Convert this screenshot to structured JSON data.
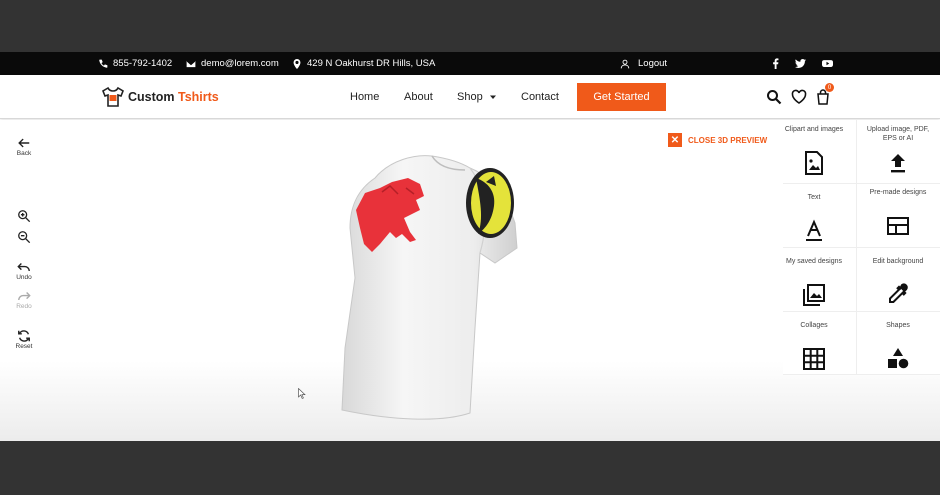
{
  "topbar": {
    "phone": "855-792-1402",
    "email": "demo@lorem.com",
    "address": "429 N Oakhurst DR Hills, USA",
    "logout": "Logout",
    "social": [
      "facebook-icon",
      "twitter-icon",
      "youtube-icon"
    ]
  },
  "nav": {
    "logo_main": "Custom ",
    "logo_accent": "Tshirts",
    "links": [
      "Home",
      "About",
      "Shop",
      "Contact"
    ],
    "cta": "Get Started",
    "cart_count": "0"
  },
  "left_tools": {
    "back": "Back",
    "undo": "Undo",
    "redo": "Redo",
    "reset": "Reset"
  },
  "preview": {
    "close_label": "CLOSE 3D PREVIEW"
  },
  "panel": {
    "items": [
      {
        "label": "Clipart and images",
        "icon": "clipart-icon"
      },
      {
        "label": "Upload image, PDF, EPS or AI",
        "icon": "upload-icon"
      },
      {
        "label": "Text",
        "icon": "text-icon"
      },
      {
        "label": "Pre-made designs",
        "icon": "premade-icon"
      },
      {
        "label": "My saved designs",
        "icon": "saved-designs-icon"
      },
      {
        "label": "Edit background",
        "icon": "eyedropper-icon"
      },
      {
        "label": "Collages",
        "icon": "collage-icon"
      },
      {
        "label": "Shapes",
        "icon": "shapes-icon"
      }
    ]
  },
  "colors": {
    "accent": "#f05a1a",
    "topbar_bg": "#0a0a0a",
    "outer_bg": "#333333"
  }
}
